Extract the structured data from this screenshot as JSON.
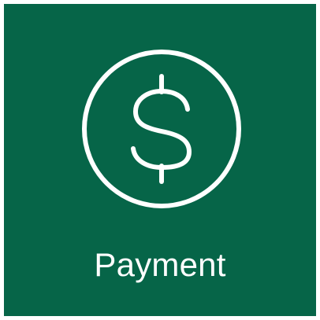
{
  "tile": {
    "label": "Payment",
    "icon": "dollar-circle-icon",
    "background_color": "#066548",
    "foreground_color": "#ffffff"
  }
}
